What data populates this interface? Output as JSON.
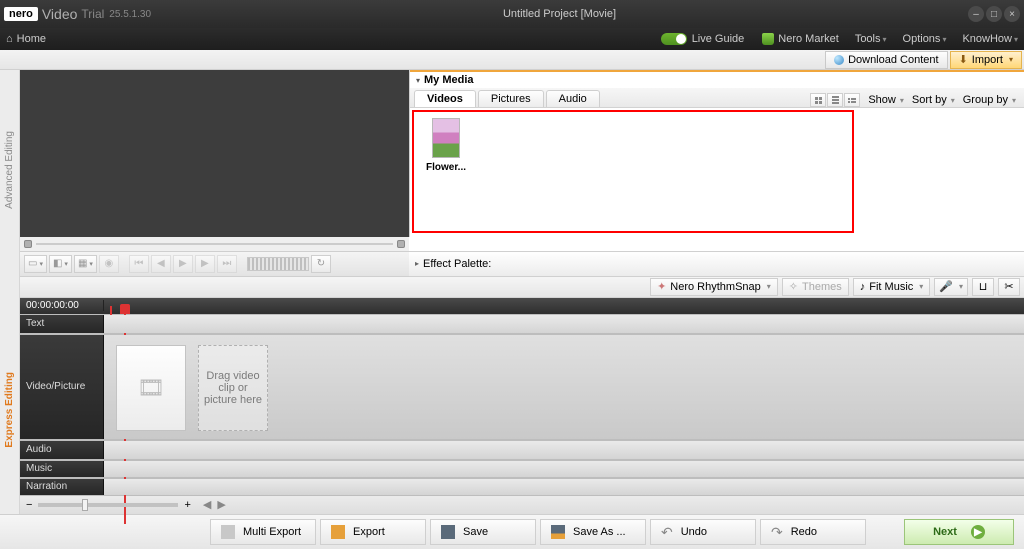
{
  "title": {
    "brand": "nero",
    "product": "Video",
    "trial": "Trial",
    "version": "25.5.1.30",
    "project": "Untitled Project [Movie]"
  },
  "menubar": {
    "home": "Home",
    "live_guide": "Live Guide",
    "market": "Nero Market",
    "tools": "Tools",
    "options": "Options",
    "knowhow": "KnowHow"
  },
  "dlbar": {
    "download": "Download Content",
    "import": "Import"
  },
  "rails": {
    "advanced": "Advanced Editing",
    "express": "Express Editing"
  },
  "media": {
    "title": "My Media",
    "tabs": {
      "videos": "Videos",
      "pictures": "Pictures",
      "audio": "Audio"
    },
    "filters": {
      "show": "Show",
      "sort": "Sort by",
      "group": "Group by"
    },
    "items": [
      {
        "label": "Flower..."
      }
    ]
  },
  "effect_palette": "Effect Palette:",
  "rsrow": {
    "rhythmsnap": "Nero RhythmSnap",
    "themes": "Themes",
    "fitmusic": "Fit Music"
  },
  "timeline": {
    "timecode": "00:00:00:00",
    "tracks": {
      "text": "Text",
      "vp": "Video/Picture",
      "audio": "Audio",
      "music": "Music",
      "narration": "Narration"
    },
    "dropzone": "Drag  video clip or picture here"
  },
  "actions": {
    "multi_export": "Multi Export",
    "export": "Export",
    "save": "Save",
    "save_as": "Save As ...",
    "undo": "Undo",
    "redo": "Redo",
    "next": "Next"
  }
}
